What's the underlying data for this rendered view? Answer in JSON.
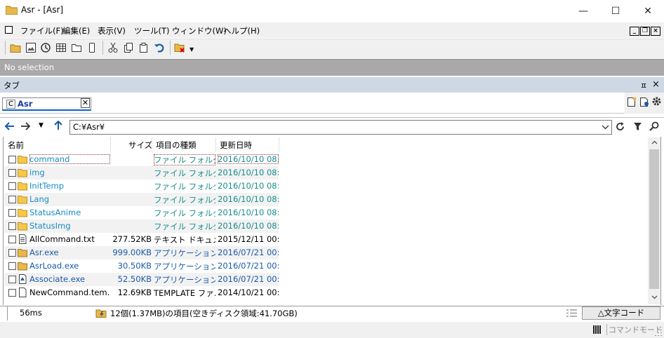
{
  "window": {
    "title": "Asr - [Asr]",
    "minimize_glyph": "—",
    "maximize_glyph": "☐",
    "close_glyph": "✕"
  },
  "menu": {
    "items": [
      "ファイル(F)",
      "編集(E)",
      "表示(V)",
      "ツール(T)",
      "ウィンドウ(W)",
      "ヘルプ(H)"
    ],
    "mdi_minimize": "_",
    "mdi_restore": "❐",
    "mdi_close": "×"
  },
  "toolbar": {
    "icons": [
      "folder-icon",
      "image-view-icon",
      "history-icon",
      "grid-view-icon",
      "tab-folder-icon",
      "device-icon",
      "cut-icon",
      "copy-icon",
      "paste-icon",
      "undo-icon",
      "delete-folder-icon"
    ]
  },
  "selection_bar": {
    "text": "No selection"
  },
  "tab_panel": {
    "title": "タブ",
    "pin_glyph": "ㅍ",
    "close_glyph": "×",
    "tab": {
      "prefix": "C",
      "label": "Asr",
      "close": "✕"
    }
  },
  "nav": {
    "path": "C:¥Asr¥"
  },
  "columns": [
    "名前",
    "サイズ",
    "項目の種類",
    "更新日時"
  ],
  "files": [
    {
      "name": "command",
      "size": "",
      "type": "ファイル フォルダー",
      "date": "2016/10/10 08:...",
      "kind": "folder",
      "icon": "folder-icon"
    },
    {
      "name": "img",
      "size": "",
      "type": "ファイル フォルダー",
      "date": "2016/10/10 08:...",
      "kind": "folder",
      "icon": "folder-icon"
    },
    {
      "name": "InitTemp",
      "size": "",
      "type": "ファイル フォルダー",
      "date": "2016/10/10 08:...",
      "kind": "folder",
      "icon": "folder-icon"
    },
    {
      "name": "Lang",
      "size": "",
      "type": "ファイル フォルダー",
      "date": "2016/10/10 08:...",
      "kind": "folder",
      "icon": "folder-icon"
    },
    {
      "name": "StatusAnime",
      "size": "",
      "type": "ファイル フォルダー",
      "date": "2016/10/10 08:...",
      "kind": "folder",
      "icon": "folder-icon"
    },
    {
      "name": "StatusImg",
      "size": "",
      "type": "ファイル フォルダー",
      "date": "2016/10/10 08:...",
      "kind": "folder",
      "icon": "folder-icon"
    },
    {
      "name": "AllCommand.txt",
      "size": "277.52KB",
      "type": "テキスト ドキュメ...",
      "date": "2015/12/11 00:...",
      "kind": "txt",
      "icon": "text-file-icon"
    },
    {
      "name": "Asr.exe",
      "size": "999.00KB",
      "type": "アプリケーション",
      "date": "2016/07/21 00:...",
      "kind": "exe",
      "icon": "app-icon"
    },
    {
      "name": "AsrLoad.exe",
      "size": "30.50KB",
      "type": "アプリケーション",
      "date": "2016/07/21 00:...",
      "kind": "exe",
      "icon": "app-icon"
    },
    {
      "name": "Associate.exe",
      "size": "52.50KB",
      "type": "アプリケーション",
      "date": "2016/07/21 00:...",
      "kind": "exe",
      "icon": "associate-app-icon"
    },
    {
      "name": "NewCommand.tem...",
      "size": "12.69KB",
      "type": "TEMPLATE ファ...",
      "date": "2014/10/21 00:...",
      "kind": "txt",
      "icon": "file-icon"
    }
  ],
  "status": {
    "time": "56ms",
    "info": "12個(1.37MB)の項目(空きディスク領域:41.70GB)",
    "charcode_button": "△文字コード"
  },
  "mode": {
    "label": "コマンドモード"
  }
}
